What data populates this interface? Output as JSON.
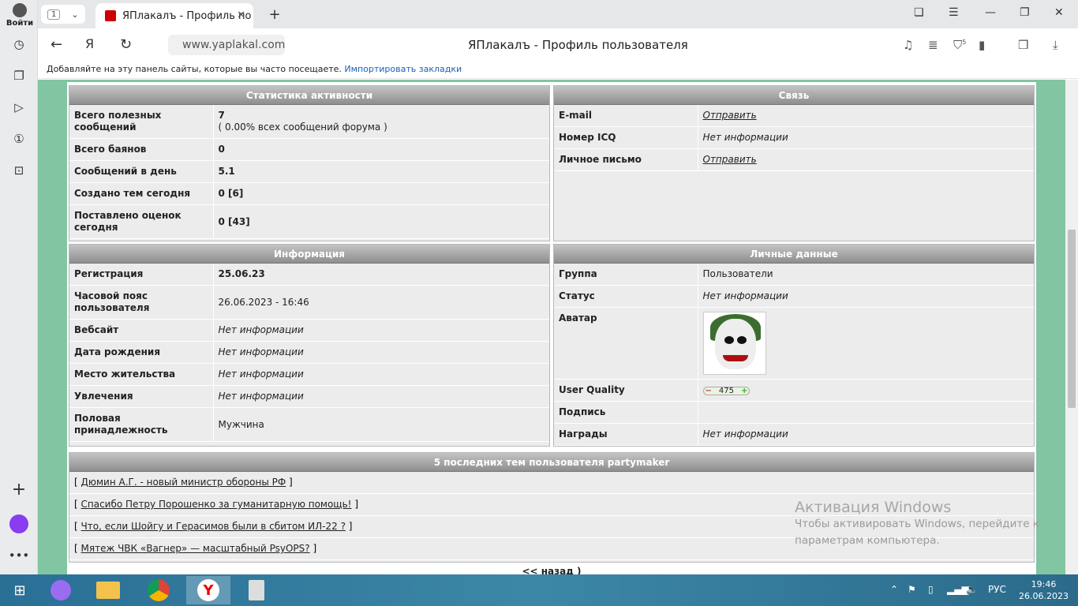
{
  "browser": {
    "login": "Войти",
    "tab_count": "1",
    "tab_title": "ЯПлакалъ - Профиль по",
    "url": "www.yaplakal.com",
    "page_title": "ЯПлакалъ - Профиль пользователя",
    "badge": "5",
    "bookmarks_text": "Добавляйте на эту панель сайты, которые вы часто посещаете.",
    "bookmarks_link": "Импортировать закладки"
  },
  "activity": {
    "title": "Статистика активности",
    "rows": [
      {
        "k": "Всего полезных сообщений",
        "v": "7",
        "v2": "( 0.00% всех сообщений форума )"
      },
      {
        "k": "Всего баянов",
        "v": "0"
      },
      {
        "k": "Сообщений в день",
        "v": "5.1"
      },
      {
        "k": "Создано тем сегодня",
        "v": "0 [6]"
      },
      {
        "k": "Поставлено оценок сегодня",
        "v": "0 [43]"
      }
    ]
  },
  "contact": {
    "title": "Связь",
    "rows": [
      {
        "k": "E-mail",
        "v": "Отправить"
      },
      {
        "k": "Номер ICQ",
        "v": "Нет информации"
      },
      {
        "k": "Личное письмо",
        "v": "Отправить"
      }
    ]
  },
  "info": {
    "title": "Информация",
    "rows": [
      {
        "k": "Регистрация",
        "v": "25.06.23"
      },
      {
        "k": "Часовой пояс пользователя",
        "v": "26.06.2023 - 16:46"
      },
      {
        "k": "Вебсайт",
        "v": "Нет информации"
      },
      {
        "k": "Дата рождения",
        "v": "Нет информации"
      },
      {
        "k": "Место жительства",
        "v": "Нет информации"
      },
      {
        "k": "Увлечения",
        "v": "Нет информации"
      },
      {
        "k": "Половая принадлежность",
        "v": "Мужчина"
      }
    ]
  },
  "personal": {
    "title": "Личные данные",
    "rows": [
      {
        "k": "Группа",
        "v": "Пользователи"
      },
      {
        "k": "Статус",
        "v": "Нет информации"
      },
      {
        "k": "Аватар",
        "v": ""
      },
      {
        "k": "User Quality",
        "v": "475"
      },
      {
        "k": "Подпись",
        "v": ""
      },
      {
        "k": "Награды",
        "v": "Нет информации"
      }
    ]
  },
  "topics": {
    "title": "5 последних тем пользователя partymaker",
    "items": [
      "Дюмин А.Г. - новый министр обороны РФ",
      "Спасибо Петру Порошенко за гуманитарную помощь!",
      "Что, если Шойгу и Герасимов были в сбитом ИЛ-22 ?",
      "Мятеж ЧВК «Вагнер» — масштабный PsyOPS?"
    ]
  },
  "bottom_cut": "<< назад )",
  "watermark": {
    "title": "Активация Windows",
    "line1": "Чтобы активировать Windows, перейдите к",
    "line2": "параметрам компьютера."
  },
  "tray": {
    "lang": "РУС",
    "time": "19:46",
    "date": "26.06.2023"
  },
  "colors": {
    "page_bg": "#82c5a2",
    "header_grad": "#8e8e8e",
    "row_bg": "#ececec"
  }
}
